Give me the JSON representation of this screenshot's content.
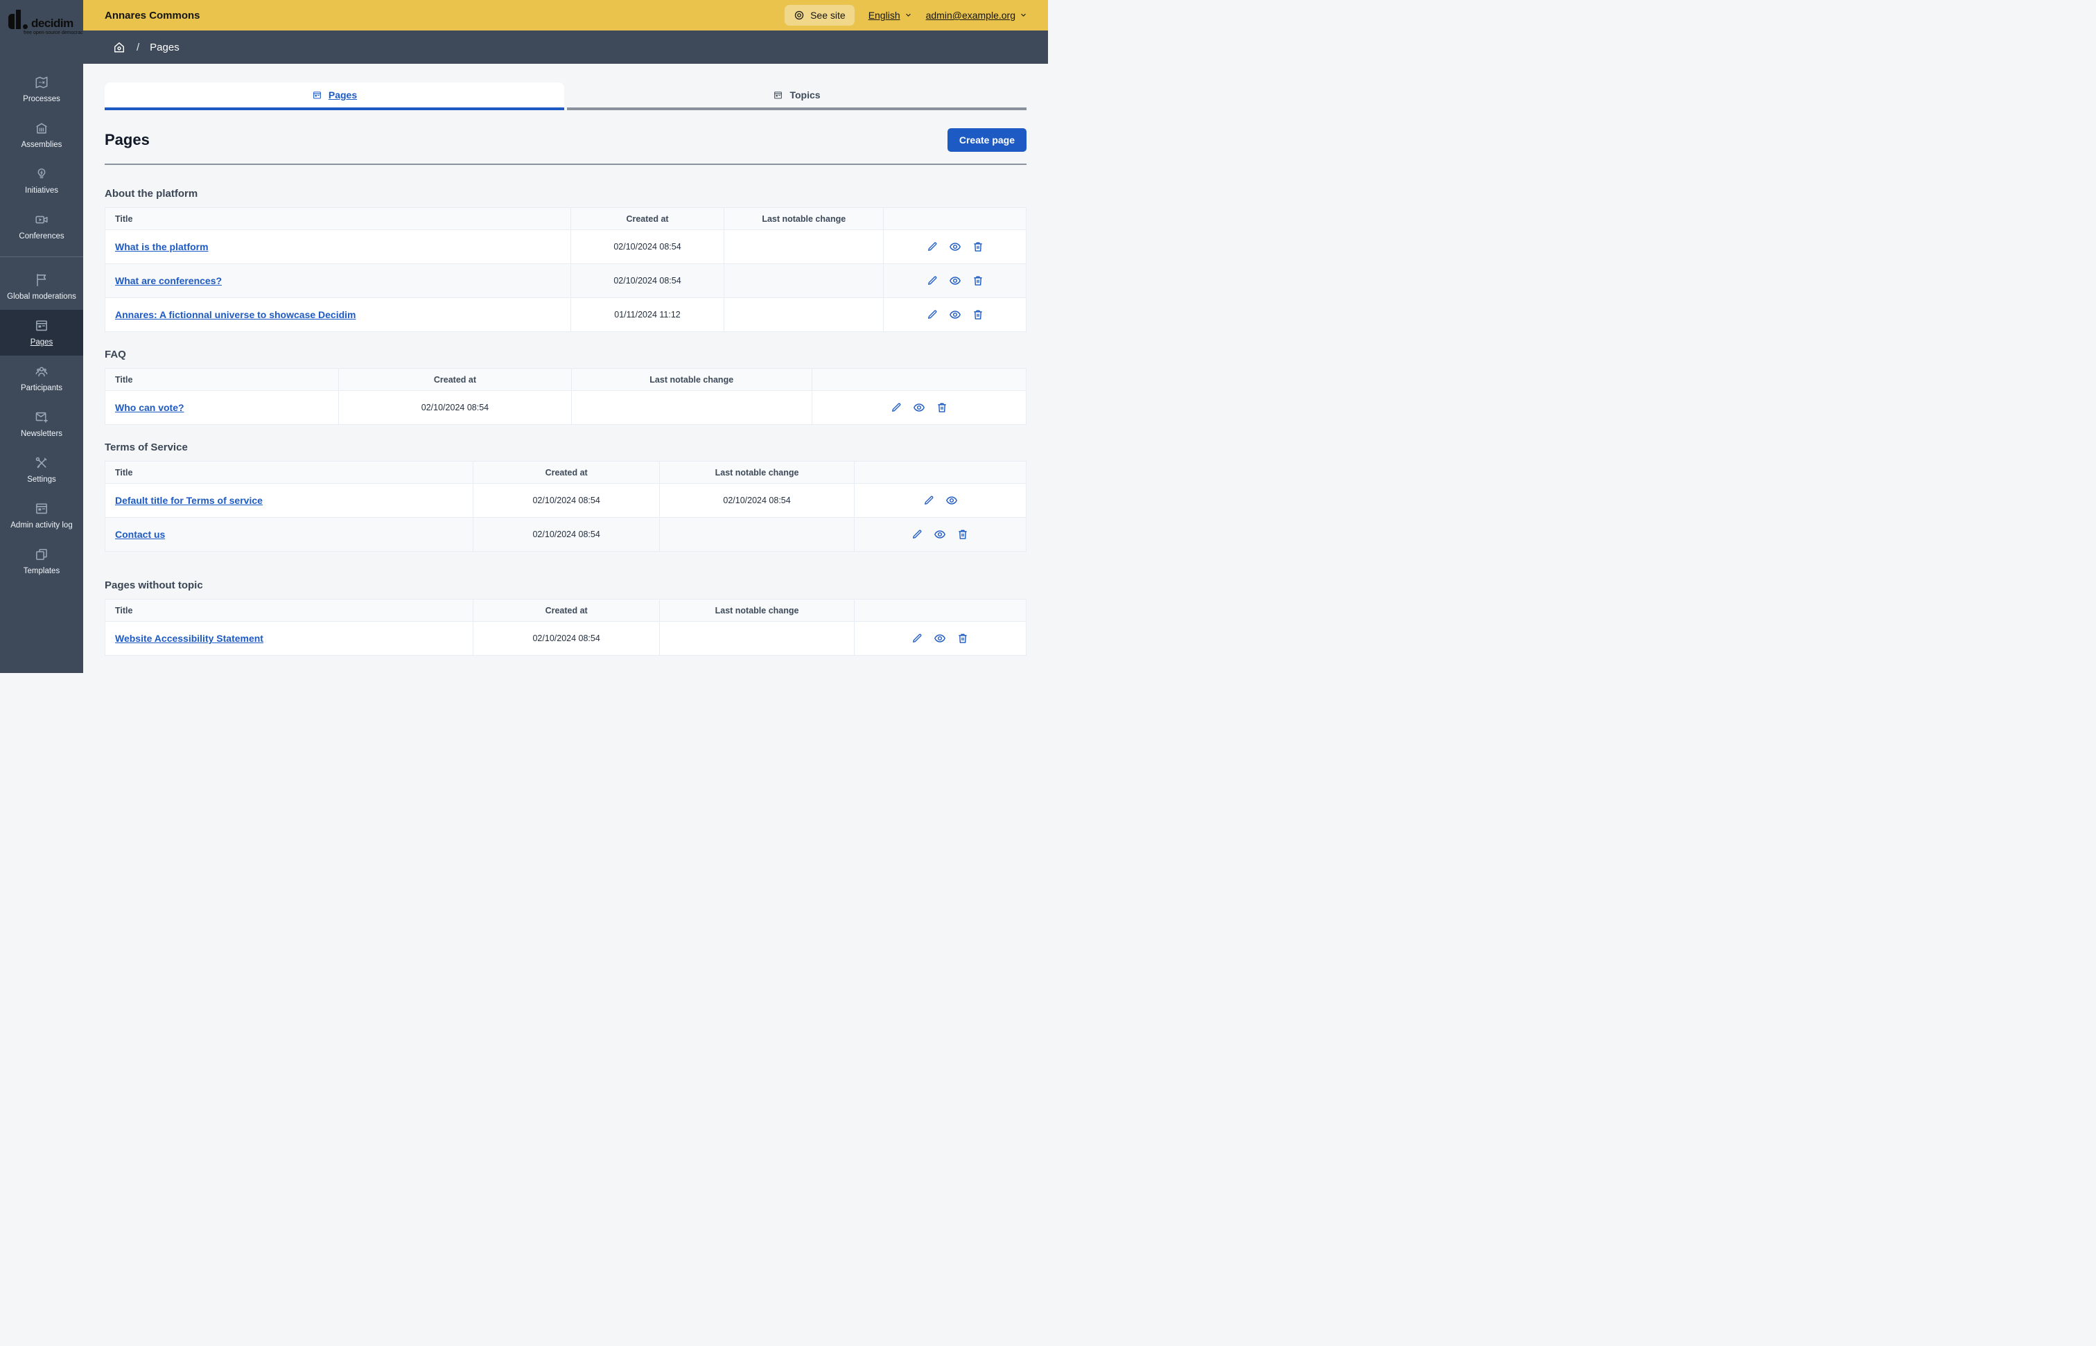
{
  "logo": {
    "brand": "decidim",
    "tagline": "free open-source democracy"
  },
  "topbar": {
    "org_name": "Annares Commons",
    "see_site": "See site",
    "language": "English",
    "user_email": "admin@example.org"
  },
  "breadcrumb": {
    "current": "Pages"
  },
  "sidebar": {
    "items": [
      {
        "slug": "processes",
        "label": "Processes",
        "icon": "processes-map-icon"
      },
      {
        "slug": "assemblies",
        "label": "Assemblies",
        "icon": "assemblies-building-icon"
      },
      {
        "slug": "initiatives",
        "label": "Initiatives",
        "icon": "initiatives-lightbulb-icon"
      },
      {
        "slug": "conferences",
        "label": "Conferences",
        "icon": "conferences-video-icon"
      },
      {
        "slug": "global-moderations",
        "label": "Global moderations",
        "icon": "moderations-flag-icon",
        "divider_before": true
      },
      {
        "slug": "pages",
        "label": "Pages",
        "icon": "pages-newspaper-icon",
        "active": true
      },
      {
        "slug": "participants",
        "label": "Participants",
        "icon": "participants-people-icon"
      },
      {
        "slug": "newsletters",
        "label": "Newsletters",
        "icon": "newsletters-mail-add-icon"
      },
      {
        "slug": "settings",
        "label": "Settings",
        "icon": "settings-tools-icon"
      },
      {
        "slug": "admin-activity-log",
        "label": "Admin activity log",
        "icon": "activity-log-newspaper-icon"
      },
      {
        "slug": "templates",
        "label": "Templates",
        "icon": "templates-copy-icon"
      }
    ]
  },
  "tabs": [
    {
      "slug": "pages",
      "label": "Pages",
      "icon": "pages-newspaper-icon",
      "active": true
    },
    {
      "slug": "topics",
      "label": "Topics",
      "icon": "topics-newspaper-icon",
      "active": false
    }
  ],
  "page": {
    "title": "Pages",
    "create_button": "Create page"
  },
  "sections": [
    {
      "heading": "About the platform",
      "columns": [
        "Title",
        "Created at",
        "Last notable change",
        ""
      ],
      "column_widths_percent": [
        50.5,
        16.7,
        17.3,
        15.5
      ],
      "rows": [
        {
          "title": "What is the platform",
          "created_at": "02/10/2024 08:54",
          "last_change": "",
          "actions": [
            "edit",
            "preview",
            "delete"
          ]
        },
        {
          "title": "What are conferences?",
          "created_at": "02/10/2024 08:54",
          "last_change": "",
          "actions": [
            "edit",
            "preview",
            "delete"
          ]
        },
        {
          "title": "Annares: A fictionnal universe to showcase Decidim",
          "created_at": "01/11/2024 11:12",
          "last_change": "",
          "actions": [
            "edit",
            "preview",
            "delete"
          ]
        }
      ]
    },
    {
      "heading": "FAQ",
      "columns": [
        "Title",
        "Created at",
        "Last notable change",
        ""
      ],
      "column_widths_percent": [
        25.3,
        25.3,
        26.1,
        23.3
      ],
      "rows": [
        {
          "title": "Who can vote?",
          "created_at": "02/10/2024 08:54",
          "last_change": "",
          "actions": [
            "edit",
            "preview",
            "delete"
          ]
        }
      ]
    },
    {
      "heading": "Terms of Service",
      "columns": [
        "Title",
        "Created at",
        "Last notable change",
        ""
      ],
      "column_widths_percent": [
        39.9,
        20.3,
        21.1,
        18.7
      ],
      "rows": [
        {
          "title": "Default title for Terms of service",
          "created_at": "02/10/2024 08:54",
          "last_change": "02/10/2024 08:54",
          "actions": [
            "edit",
            "preview"
          ]
        },
        {
          "title": "Contact us",
          "created_at": "02/10/2024 08:54",
          "last_change": "",
          "actions": [
            "edit",
            "preview",
            "delete"
          ]
        }
      ]
    },
    {
      "heading": "Pages without topic",
      "columns": [
        "Title",
        "Created at",
        "Last notable change",
        ""
      ],
      "column_widths_percent": [
        39.9,
        20.3,
        21.1,
        18.7
      ],
      "rows": [
        {
          "title": "Website Accessibility Statement",
          "created_at": "02/10/2024 08:54",
          "last_change": "",
          "actions": [
            "edit",
            "preview",
            "delete"
          ]
        }
      ]
    }
  ],
  "colors": {
    "primary_blue": "#1d5ac3",
    "topbar_yellow": "#e9c34c",
    "sidebar_slate": "#3e4a5a",
    "sidebar_active": "#27303f",
    "page_background": "#f4f6f8",
    "table_border": "#e8edf3"
  }
}
